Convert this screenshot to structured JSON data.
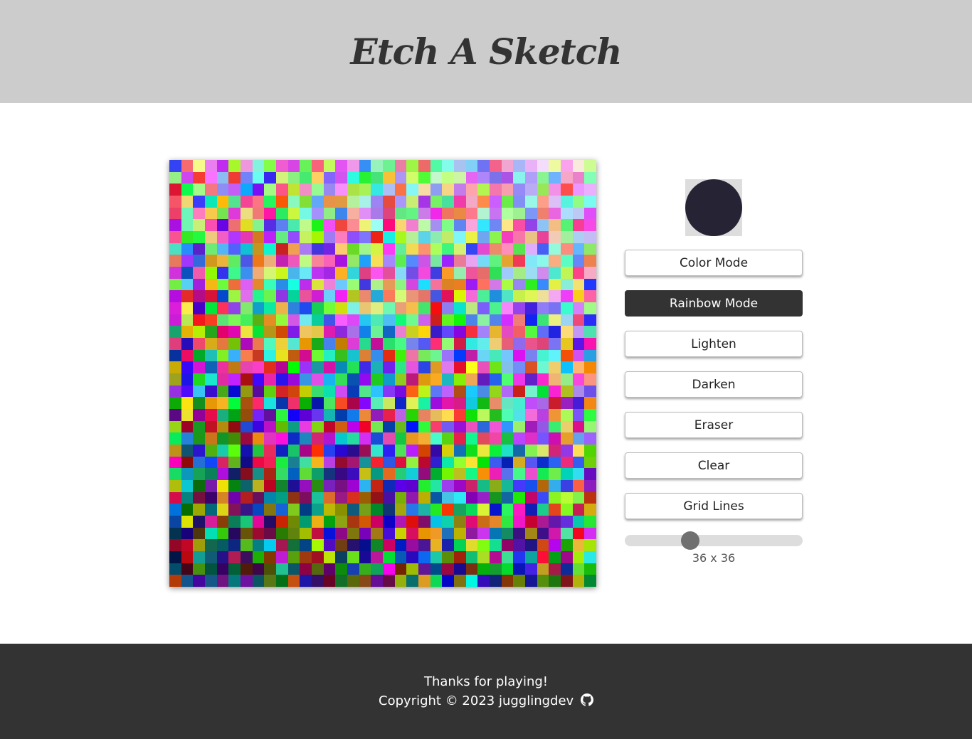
{
  "header": {
    "title": "Etch A Sketch"
  },
  "controls": {
    "current_color": "#262335",
    "buttons": [
      {
        "label": "Color Mode",
        "active": false
      },
      {
        "label": "Rainbow Mode",
        "active": true
      },
      {
        "label": "Lighten",
        "active": false
      },
      {
        "label": "Darken",
        "active": false
      },
      {
        "label": "Eraser",
        "active": false
      },
      {
        "label": "Clear",
        "active": false
      },
      {
        "label": "Grid Lines",
        "active": false
      }
    ],
    "slider": {
      "min": 1,
      "max": 100,
      "value": 36
    },
    "size_label": "36 x 36"
  },
  "board": {
    "rows": 36,
    "cols": 36,
    "mode": "rainbow"
  },
  "footer": {
    "line1": "Thanks for playing!",
    "line2": "Copyright © 2023 jugglingdev",
    "icon": "github-icon"
  },
  "colors": {
    "header_bg": "#cccccc",
    "footer_bg": "#333333",
    "accent": "#333333"
  }
}
